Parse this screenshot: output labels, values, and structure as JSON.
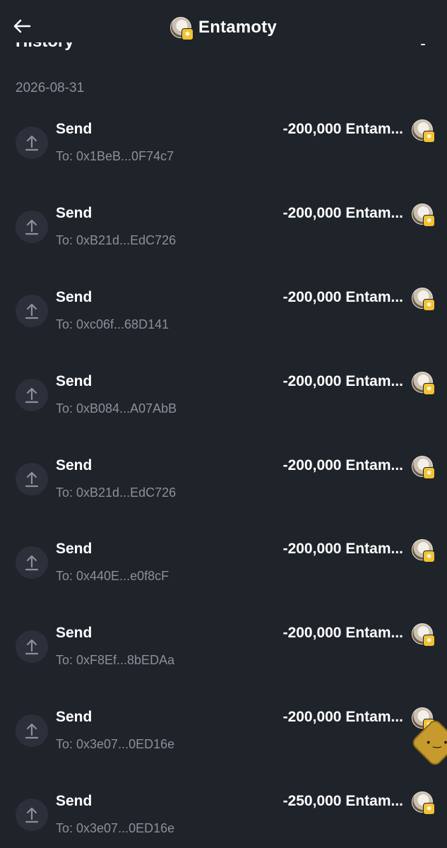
{
  "header": {
    "title": "Entamoty",
    "section_heading": "History"
  },
  "date_group": "2026-08-31",
  "transactions": [
    {
      "type": "Send",
      "to": "To: 0x1BeB...0F74c7",
      "amount": "-200,000 Entam..."
    },
    {
      "type": "Send",
      "to": "To: 0xB21d...EdC726",
      "amount": "-200,000 Entam..."
    },
    {
      "type": "Send",
      "to": "To: 0xc06f...68D141",
      "amount": "-200,000 Entam..."
    },
    {
      "type": "Send",
      "to": "To: 0xB084...A07AbB",
      "amount": "-200,000 Entam..."
    },
    {
      "type": "Send",
      "to": "To: 0xB21d...EdC726",
      "amount": "-200,000 Entam..."
    },
    {
      "type": "Send",
      "to": "To: 0x440E...e0f8cF",
      "amount": "-200,000 Entam..."
    },
    {
      "type": "Send",
      "to": "To: 0xF8Ef...8bEDAa",
      "amount": "-200,000 Entam..."
    },
    {
      "type": "Send",
      "to": "To: 0x3e07...0ED16e",
      "amount": "-200,000 Entam..."
    },
    {
      "type": "Send",
      "to": "To: 0x3e07...0ED16e",
      "amount": "-250,000 Entam..."
    }
  ],
  "icons": {
    "back": "arrow-left-icon",
    "send": "upload-arrow-icon",
    "token": "token-avatar-icon",
    "filter": "filter-icon",
    "mascot": "floating-assistant-icon"
  },
  "colors": {
    "background": "#1f232a",
    "text_primary": "#ffffff",
    "text_secondary": "#8b909a",
    "icon_circle": "#2b303a",
    "badge": "#f2c230"
  }
}
